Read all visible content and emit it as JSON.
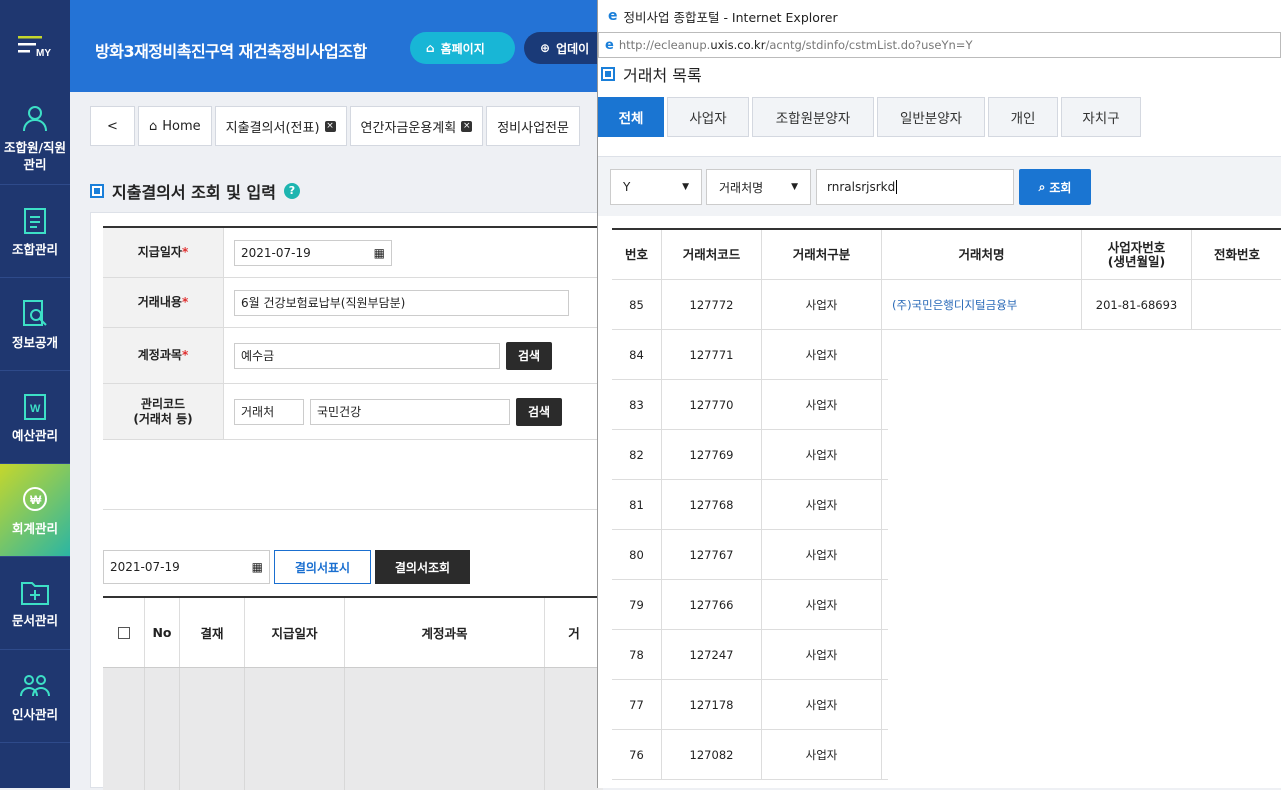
{
  "sidebar": {
    "top_label": "MY",
    "items": [
      {
        "label": "조합원/직원 관리",
        "icon": "user-icon"
      },
      {
        "label": "조합관리",
        "icon": "document-list-icon"
      },
      {
        "label": "정보공개",
        "icon": "document-search-icon"
      },
      {
        "label": "예산관리",
        "icon": "document-budget-icon"
      },
      {
        "label": "회계관리",
        "icon": "accounting-icon"
      },
      {
        "label": "문서관리",
        "icon": "folder-add-icon"
      },
      {
        "label": "인사관리",
        "icon": "people-icon"
      }
    ]
  },
  "header": {
    "title": "방화3재정비촉진구역 재건축정비사업조합",
    "home_button": "홈페이지",
    "update_button": "업데이"
  },
  "tabs": [
    "Home",
    "지출결의서(전표)",
    "연간자금운용계획",
    "정비사업전문"
  ],
  "section_title": "지출결의서 조회 및 입력",
  "form": {
    "pay_date_label": "지급일자",
    "pay_date": "2021-07-19",
    "content_label": "거래내용",
    "content": "6월 건강보험료납부(직원부담분)",
    "account_label": "계정과목",
    "account": "예수금",
    "search_label": "검색",
    "mgmt_label": "관리코드\n(거래처 등)",
    "mgmt_type": "거래처",
    "mgmt_value": "국민건강",
    "required_mark": "*"
  },
  "bottom": {
    "date": "2021-07-19",
    "show_button": "결의서표시",
    "query_button": "결의서조회"
  },
  "grid": {
    "headers": [
      "No",
      "결재",
      "지급일자",
      "계정과목",
      "거"
    ]
  },
  "popup": {
    "window_title": "정비사업 종합포털 - Internet Explorer",
    "url_prefix": "http://ecleanup.",
    "url_domain": "uxis.co.kr",
    "url_suffix": "/acntg/stdinfo/cstmList.do?useYn=Y",
    "title": "거래처 목록",
    "tabs": [
      "전체",
      "사업자",
      "조합원분양자",
      "일반분양자",
      "개인",
      "자치구"
    ],
    "filter_use": "Y",
    "filter_field": "거래처명",
    "search_value": "rnralsrjsrkd",
    "search_button": "조회",
    "columns": [
      "번호",
      "거래처코드",
      "거래처구분",
      "거래처명",
      "사업자번호\n(생년월일)",
      "전화번호"
    ],
    "rows": [
      {
        "no": "85",
        "code": "127772",
        "type": "사업자",
        "name": "(주)국민은행디지털금융부",
        "biz": "201-81-68693"
      },
      {
        "no": "84",
        "code": "127771",
        "type": "사업자"
      },
      {
        "no": "83",
        "code": "127770",
        "type": "사업자"
      },
      {
        "no": "82",
        "code": "127769",
        "type": "사업자"
      },
      {
        "no": "81",
        "code": "127768",
        "type": "사업자"
      },
      {
        "no": "80",
        "code": "127767",
        "type": "사업자"
      },
      {
        "no": "79",
        "code": "127766",
        "type": "사업자"
      },
      {
        "no": "78",
        "code": "127247",
        "type": "사업자"
      },
      {
        "no": "77",
        "code": "127178",
        "type": "사업자"
      },
      {
        "no": "76",
        "code": "127082",
        "type": "사업자"
      }
    ]
  },
  "colors": {
    "sidebar": "#1f3770",
    "header": "#2473d6",
    "accent": "#1a75d2"
  }
}
